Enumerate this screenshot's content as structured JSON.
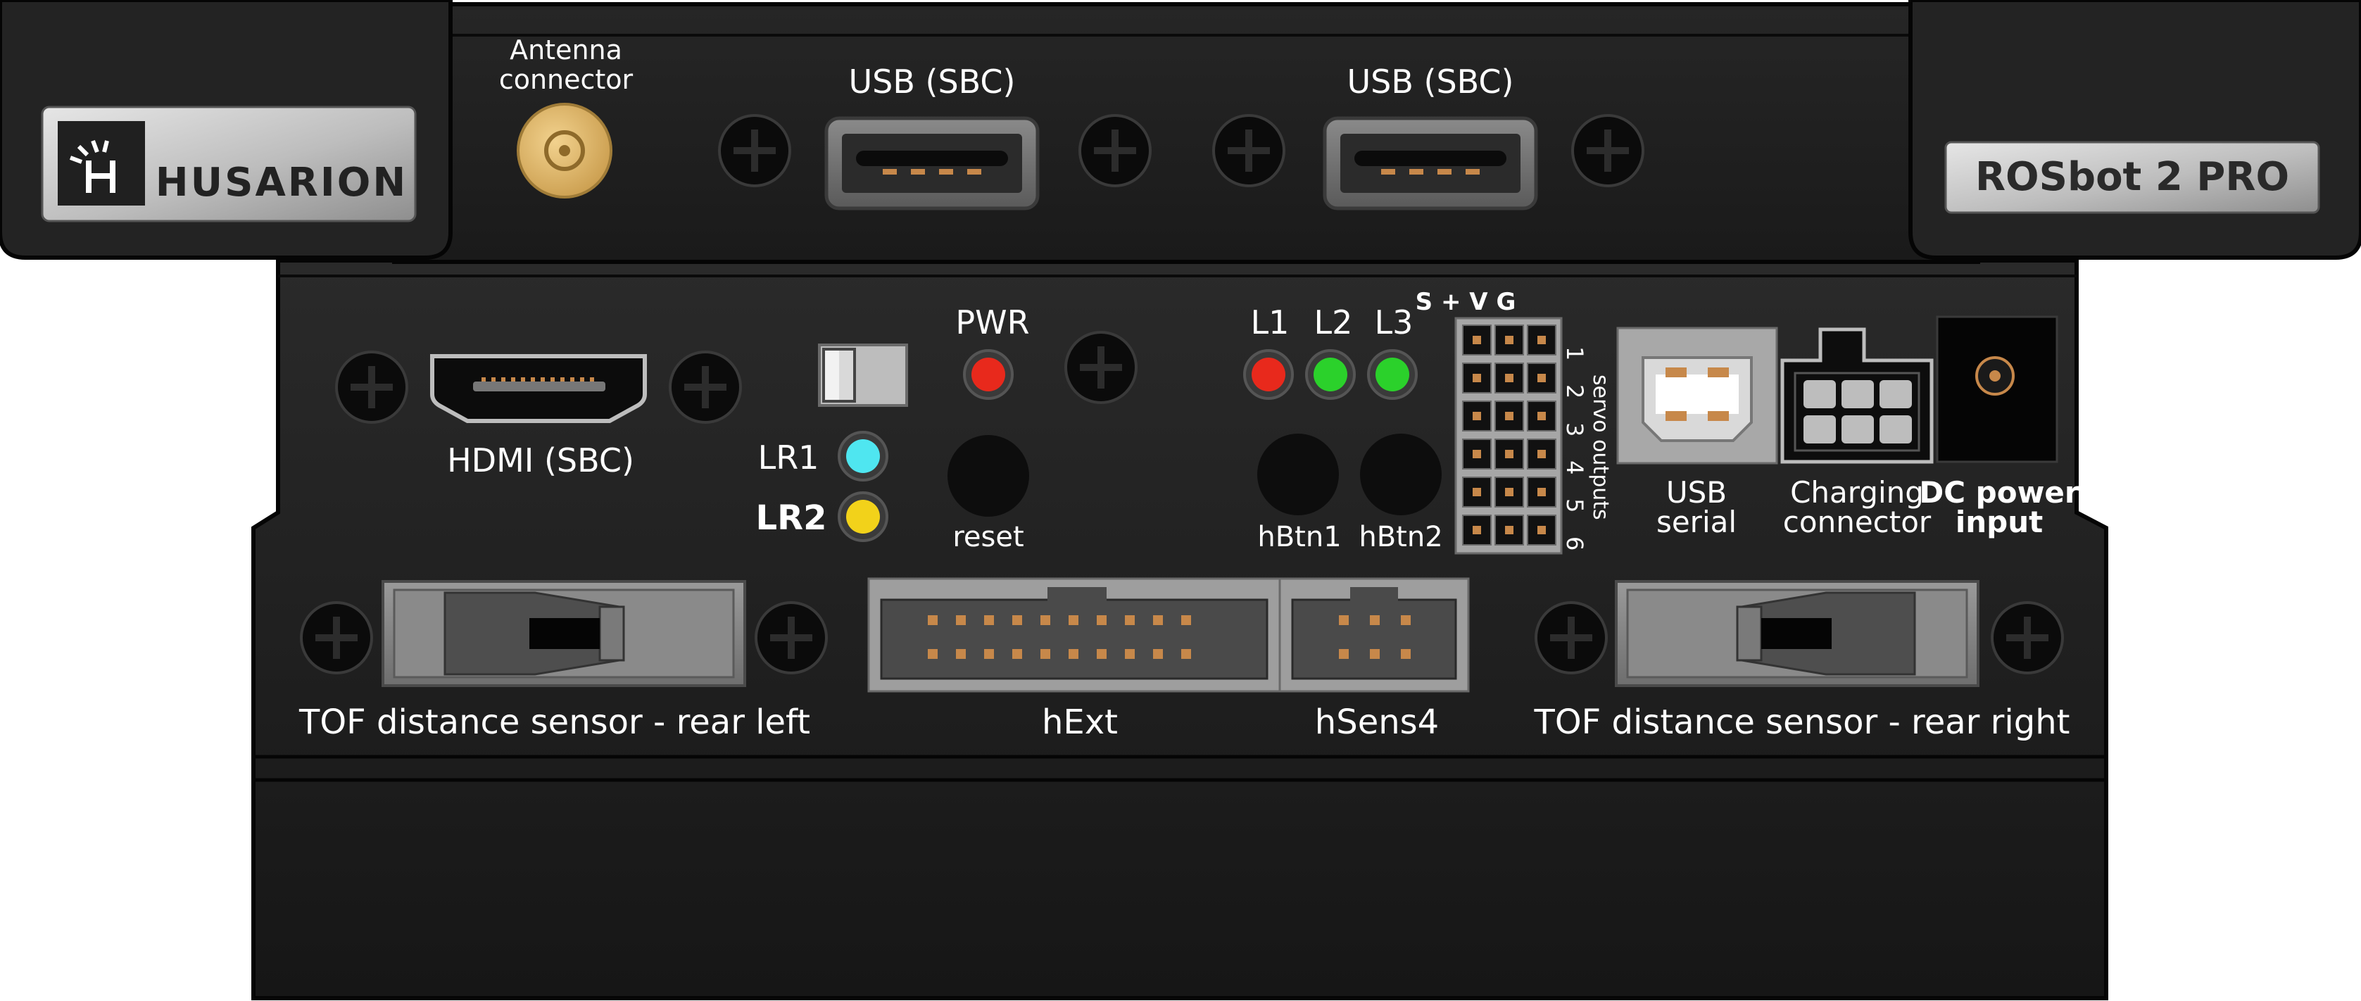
{
  "brand": {
    "logo_text": "HUSARION",
    "model_badge": "ROSbot 2 PRO"
  },
  "labels": {
    "antenna": [
      "Antenna",
      "connector"
    ],
    "usb_sbc_1": "USB (SBC)",
    "usb_sbc_2": "USB (SBC)",
    "hdmi": "HDMI (SBC)",
    "pwr": "PWR",
    "lr1": "LR1",
    "lr2": "LR2",
    "reset": "reset",
    "l1": "L1",
    "l2": "L2",
    "l3": "L3",
    "hbtn1": "hBtn1",
    "hbtn2": "hBtn2",
    "svg_header": "S + V G",
    "servo_numbers": [
      "1",
      "2",
      "3",
      "4",
      "5",
      "6"
    ],
    "servo_outputs": "servo outputs",
    "usb_serial": [
      "USB",
      "serial"
    ],
    "charging": [
      "Charging",
      "connector"
    ],
    "dc_power": [
      "DC power",
      "input"
    ],
    "tof_left": "TOF distance sensor - rear left",
    "hext": "hExt",
    "hsens4": "hSens4",
    "tof_right": "TOF distance sensor - rear right"
  },
  "colors": {
    "panel": "#1c1c1c",
    "antenna_gold": "#d8b36a",
    "led_red": "#e8291c",
    "led_green": "#2bd12b",
    "led_cyan": "#4fe6f0",
    "led_yellow": "#f2d21a",
    "pin_orange": "#c7884a"
  },
  "icons": {
    "screw": "screw-icon",
    "antenna": "antenna-connector-icon",
    "usb_a": "usb-a-port-icon",
    "hdmi": "hdmi-port-icon",
    "switch": "power-switch-icon",
    "usb_b": "usb-b-port-icon",
    "dc_jack": "dc-jack-icon"
  }
}
